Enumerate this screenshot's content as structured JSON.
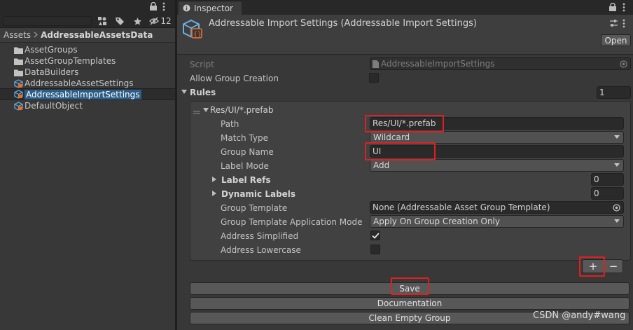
{
  "project": {
    "toolbar": {
      "search_placeholder": "",
      "hidden_count": "12"
    },
    "breadcrumb": {
      "root": "Assets",
      "current": "AddressableAssetsData"
    },
    "assets": [
      {
        "label": "AssetGroups",
        "icon": "folder-icon"
      },
      {
        "label": "AssetGroupTemplates",
        "icon": "folder-icon"
      },
      {
        "label": "DataBuilders",
        "icon": "folder-icon"
      },
      {
        "label": "AddressableAssetSettings",
        "icon": "scriptable-object-icon"
      },
      {
        "label": "AddressableImportSettings",
        "icon": "scriptable-object-icon",
        "selected": true
      },
      {
        "label": "DefaultObject",
        "icon": "scriptable-object-icon"
      }
    ]
  },
  "inspector": {
    "tab_label": "Inspector",
    "title": "Addressable Import Settings (Addressable Import Settings)",
    "open_button": "Open",
    "script": {
      "label": "Script",
      "value": "AddressableImportSettings"
    },
    "allow_group_creation": {
      "label": "Allow Group Creation",
      "checked": false
    },
    "rules": {
      "label": "Rules",
      "count": "1",
      "items": [
        {
          "title": "Res/UI/*.prefab",
          "path": {
            "label": "Path",
            "value": "Res/UI/*.prefab"
          },
          "match_type": {
            "label": "Match Type",
            "value": "Wildcard"
          },
          "group_name": {
            "label": "Group Name",
            "value": "UI"
          },
          "label_mode": {
            "label": "Label Mode",
            "value": "Add"
          },
          "label_refs": {
            "label": "Label Refs",
            "count": "0"
          },
          "dynamic_labels": {
            "label": "Dynamic Labels",
            "count": "0"
          },
          "group_template": {
            "label": "Group Template",
            "value": "None (Addressable Asset Group Template)"
          },
          "group_template_mode": {
            "label": "Group Template Application Mode",
            "value": "Apply On Group Creation Only"
          },
          "address_simplified": {
            "label": "Address Simplified",
            "checked": true
          },
          "address_lowercase": {
            "label": "Address Lowercase",
            "checked": false
          }
        }
      ]
    },
    "add_button": "+",
    "remove_button": "−",
    "buttons": {
      "save": "Save",
      "documentation": "Documentation",
      "clean_empty_group": "Clean Empty Group"
    }
  },
  "watermark": "CSDN @andy#wang",
  "colors": {
    "highlight": "#e02020",
    "selection": "#2c5d87",
    "panel": "#383838"
  }
}
